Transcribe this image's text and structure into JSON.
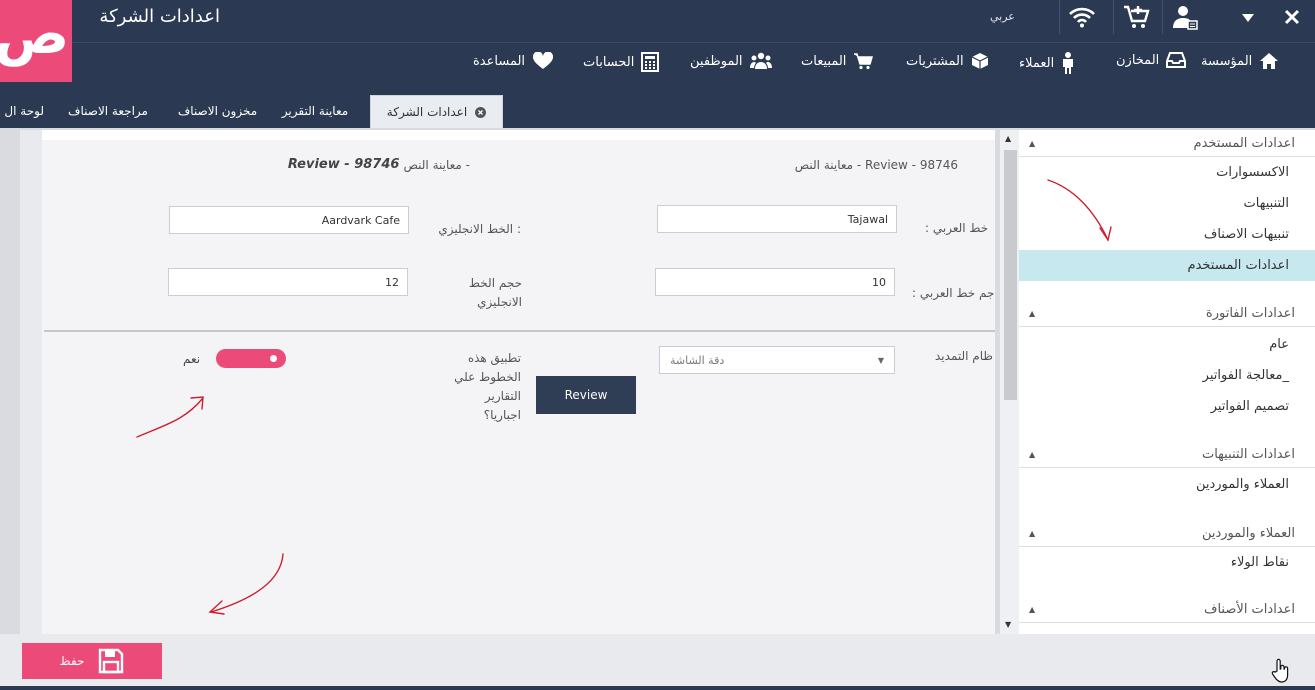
{
  "titlebar": {
    "app_title": "اعدادات الشركة",
    "language": "عربي",
    "logo_text": "ص"
  },
  "menu": [
    {
      "label": "المؤسسة",
      "icon": "home-icon"
    },
    {
      "label": "المخازن",
      "icon": "inbox-icon"
    },
    {
      "label": "العملاء",
      "icon": "person-icon"
    },
    {
      "label": "المشتريات",
      "icon": "cube-icon"
    },
    {
      "label": "المبيعات",
      "icon": "cart-icon"
    },
    {
      "label": "الموظفين",
      "icon": "users-icon"
    },
    {
      "label": "الحسابات",
      "icon": "calculator-icon"
    },
    {
      "label": "المساعدة",
      "icon": "heart-icon"
    }
  ],
  "tabs": {
    "active": "اعدادات الشركة",
    "others": [
      "معاينة التقرير",
      "مخزون الاصناف",
      "مراجعة الاصناف",
      "لوحة ال"
    ]
  },
  "form": {
    "preview_arabic": "معاينة النص - Review - 98746",
    "preview_english_label": "معاينة النص -",
    "preview_english_value": "Review - 98746",
    "arabic_font_label": "خط العربي :",
    "arabic_font_value": "Tajawal",
    "english_font_label": "الخط الانجليزي :",
    "english_font_value": "Aardvark Cafe",
    "arabic_size_label": "جم خط العربي :",
    "arabic_size_value": "10",
    "english_size_label": "حجم الخط الانجليزي",
    "english_size_value": "12",
    "stretch_label": "ظام التمديد",
    "stretch_value": "دقة الشاشة",
    "apply_label": "تطبيق هذه الخطوط علي التقارير اجباريا؟",
    "review_button": "Review",
    "toggle_label": "نعم",
    "toggle_on": true
  },
  "sidebar": {
    "sections": [
      {
        "title": "اعدادات المستخدم",
        "items": [
          "الاكسسوارات",
          "التنبيهات",
          "تنبيهات الاصناف",
          "اعدادات المستخدم"
        ]
      },
      {
        "title": "اعدادات الفاتورة",
        "items": [
          "عام",
          "معالجة الفواتير_",
          "تصميم الفواتير"
        ]
      },
      {
        "title": "اعدادات التنبيهات",
        "items": [
          "العملاء والموردين"
        ]
      },
      {
        "title": "العملاء والموردين",
        "items": [
          "نقاط الولاء"
        ]
      },
      {
        "title": "اعدادات الأصناف",
        "items": []
      }
    ],
    "active_item": "اعدادات المستخدم"
  },
  "footer": {
    "save_label": "حفظ"
  },
  "colors": {
    "navy": "#2b3a52",
    "accent": "#ec4a78",
    "active_item": "#c6e8ee",
    "annotation": "#cc1f2e"
  }
}
